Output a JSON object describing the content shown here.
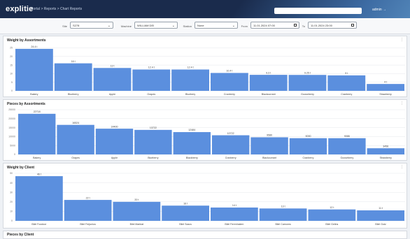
{
  "header": {
    "logo": "explitie",
    "breadcrumb": "Portal > Reports > Chart Reports",
    "user": "admin →"
  },
  "filters": [
    {
      "label": "Site",
      "value": "S278"
    },
    {
      "label": "Machine",
      "value": "WILLIAM DEI"
    },
    {
      "label": "Station",
      "value": "None"
    },
    {
      "label": "From",
      "value": "11.01.2024 07:00"
    },
    {
      "label": "To",
      "value": "11.01.2024 23:00"
    }
  ],
  "colors": {
    "bar": "#5b8fde",
    "nav": "#1a2b4c"
  },
  "panels": [
    {
      "title": "Weight by Assortments"
    },
    {
      "title": "Pieces by Assortments"
    },
    {
      "title": "Weight by Client"
    },
    {
      "title": "Pieces by Client"
    }
  ],
  "chart_data": [
    {
      "type": "bar",
      "title": "Weight by Assortments",
      "categories": [
        "Bakery",
        "Blueberry",
        "Apple",
        "Grapes",
        "Bluebery",
        "Cranberry",
        "Blackcurrant",
        "Gooseberry",
        "Cranberry",
        "Strawberry"
      ],
      "values": [
        24.4,
        16.0,
        13.3,
        12.4,
        12.4,
        10.4,
        9.3,
        9.25,
        9.0,
        4.0
      ],
      "value_labels": [
        "24.4 t",
        "16 t",
        "13 t",
        "12.4 t",
        "12.4 t",
        "10.4 t",
        "9.3 t",
        "9.25 t",
        "9 t",
        "4 t"
      ],
      "yticks": [
        "0",
        "5",
        "10",
        "15",
        "20",
        "25"
      ],
      "ylim": [
        0,
        26
      ]
    },
    {
      "type": "bar",
      "title": "Pieces by Assortments",
      "categories": [
        "Bakery",
        "Grapes",
        "Apple",
        "Blueberry",
        "Blackberry",
        "Cranberry",
        "Blackcurrant",
        "Cranberry",
        "Gooseberry",
        "Strawberry"
      ],
      "values": [
        22718,
        16524,
        14400,
        13722,
        12484,
        10722,
        9580,
        9090,
        9086,
        3456
      ],
      "value_labels": [
        "22718",
        "16524",
        "14400",
        "13722",
        "12484",
        "10722",
        "9580",
        "9090",
        "9086",
        "3456"
      ],
      "yticks": [
        "0",
        "5000",
        "10000",
        "15000",
        "20000",
        "25000"
      ],
      "ylim": [
        0,
        25000
      ]
    },
    {
      "type": "bar",
      "title": "Weight by Client",
      "categories": [
        "Bilel Foodcor",
        "Bilel Ferjunius",
        "Bilel Markiat",
        "Bilel Szacs",
        "Bilel Ferenhalem",
        "Bilel Carnoms",
        "Bilel Gelins",
        "Bilel Gutz"
      ],
      "values": [
        47.0,
        22.0,
        20.0,
        16.0,
        14.0,
        13.0,
        12.0,
        11.0
      ],
      "value_labels": [
        "46 t",
        "22 t",
        "20 t",
        "16 t",
        "14 t",
        "13 t",
        "12 t",
        "11 t"
      ],
      "yticks": [
        "0",
        "10",
        "20",
        "30",
        "40",
        "50"
      ],
      "ylim": [
        0,
        50
      ]
    }
  ]
}
